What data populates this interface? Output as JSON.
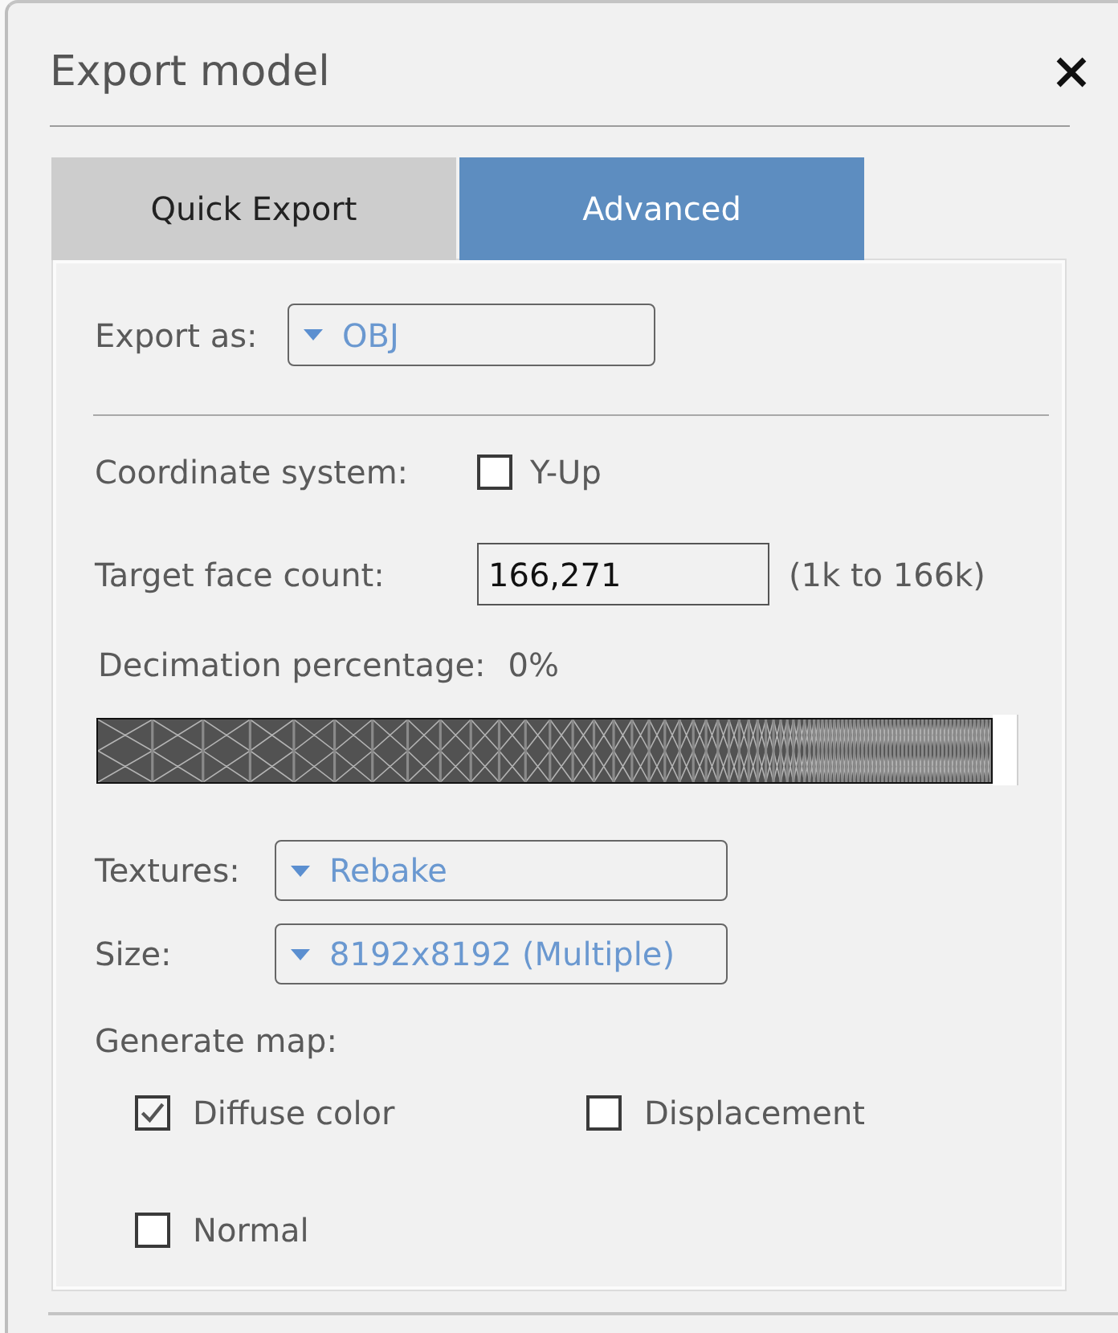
{
  "dialog": {
    "title": "Export model"
  },
  "tabs": [
    {
      "label": "Quick Export",
      "selected": false
    },
    {
      "label": "Advanced",
      "selected": true
    }
  ],
  "export_as": {
    "label": "Export as:",
    "value": "OBJ"
  },
  "coordinate_system": {
    "label": "Coordinate system:",
    "option": {
      "label": "Y-Up",
      "checked": false
    }
  },
  "target_face_count": {
    "label": "Target face count:",
    "value": "166,271",
    "range": "(1k to 166k)"
  },
  "decimation": {
    "label": "Decimation percentage:",
    "value": "0%",
    "level": 1
  },
  "textures": {
    "label": "Textures:",
    "value": "Rebake"
  },
  "size": {
    "label": "Size:",
    "value": "8192x8192 (Multiple)"
  },
  "generate_map": {
    "label": "Generate map:",
    "options": [
      {
        "label": "Diffuse color",
        "checked": true
      },
      {
        "label": "Displacement",
        "checked": false
      },
      {
        "label": "Normal",
        "checked": false
      }
    ]
  }
}
